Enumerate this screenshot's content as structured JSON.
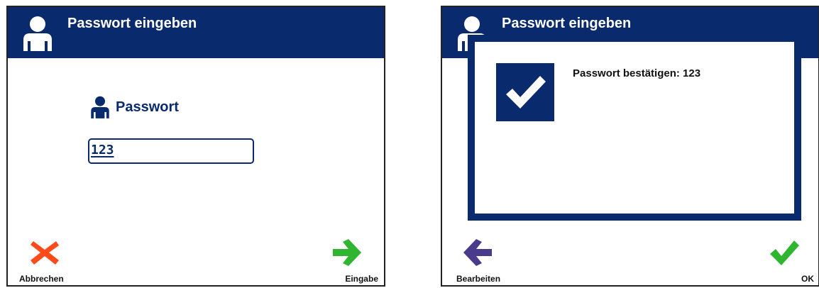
{
  "left_screen": {
    "title": "Passwort eingeben",
    "password_label": "Passwort",
    "password_value": "123",
    "cancel_label": "Abbrechen",
    "enter_label": "Eingabe",
    "icons": {
      "header": "user-icon",
      "field": "user-icon",
      "cancel": "red-x-icon",
      "enter": "green-arrow-right-icon"
    }
  },
  "right_screen": {
    "title": "Passwort eingeben",
    "dialog_text": "Passwort bestätigen: 123",
    "edit_label": "Bearbeiten",
    "ok_label": "OK",
    "icons": {
      "dialog": "checkmark-icon",
      "edit": "purple-arrow-left-icon",
      "ok": "green-check-icon"
    }
  },
  "colors": {
    "brand_blue": "#0a2a6e",
    "cancel_red": "#ff4a1a",
    "enter_green": "#2fb52f",
    "edit_purple": "#4a3a8c"
  }
}
